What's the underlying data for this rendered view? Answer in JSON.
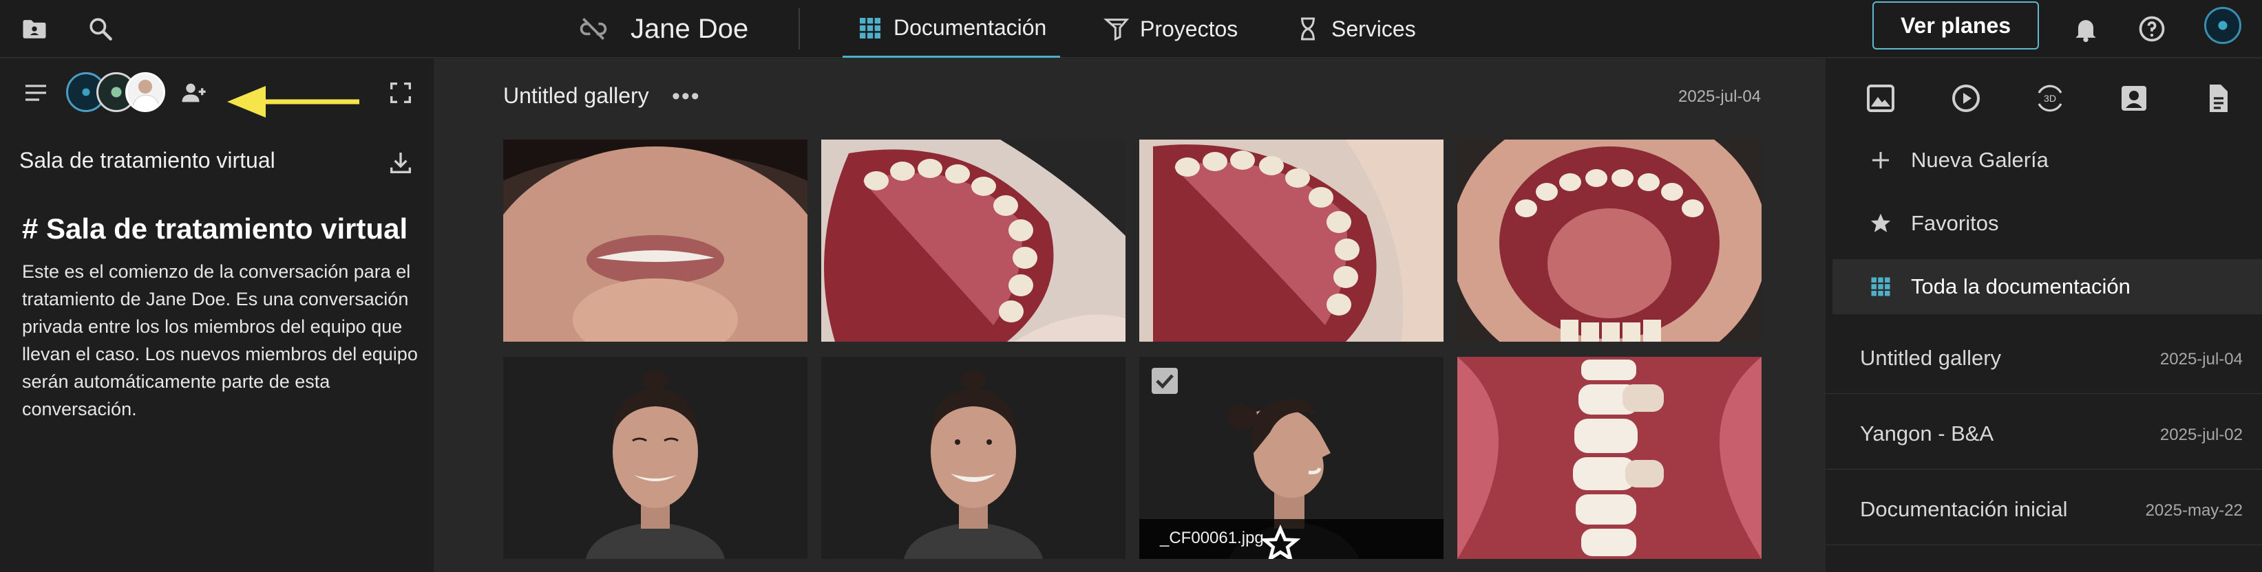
{
  "header": {
    "patient_name": "Jane Doe",
    "tabs": [
      {
        "label": "Documentación",
        "icon": "grid-icon",
        "active": true
      },
      {
        "label": "Proyectos",
        "icon": "project-filter-icon",
        "active": false
      },
      {
        "label": "Services",
        "icon": "hourglass-icon",
        "active": false
      }
    ],
    "plans_button": "Ver planes",
    "accent_color": "#4fb1c9"
  },
  "left_panel": {
    "room_title": "Sala de tratamiento virtual",
    "heading": "# Sala de tratamiento virtual",
    "description": "Este es el comienzo de la conversación para el tratamiento de Jane Doe. Es una conversación privada entre los los miembros del equipo que llevan el caso. Los nuevos miembros del equipo serán automáticamente parte de esta conversación."
  },
  "gallery": {
    "title": "Untitled gallery",
    "more": "•••",
    "date": "2025-jul-04",
    "selected_caption": "_CF00061.jpg"
  },
  "right_panel": {
    "menu": [
      {
        "label": "Nueva Galería",
        "icon": "plus-icon"
      },
      {
        "label": "Favoritos",
        "icon": "star-icon"
      },
      {
        "label": "Toda la documentación",
        "icon": "grid-icon",
        "selected": true
      }
    ],
    "galleries": [
      {
        "name": "Untitled gallery",
        "date": "2025-jul-04"
      },
      {
        "name": "Yangon - B&A",
        "date": "2025-jul-02"
      },
      {
        "name": "Documentación inicial",
        "date": "2025-may-22"
      }
    ],
    "media_icons": [
      "image-icon",
      "video-play-icon",
      "3d-icon",
      "portrait-icon",
      "document-icon"
    ],
    "three_d_label": "3D"
  }
}
